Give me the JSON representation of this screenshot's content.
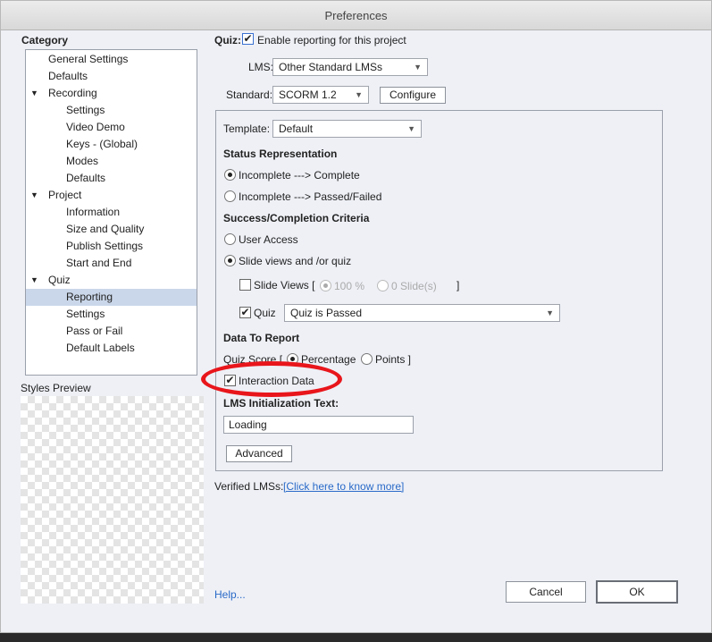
{
  "window": {
    "title": "Preferences"
  },
  "sidebar": {
    "heading": "Category",
    "items": [
      {
        "label": "General Settings",
        "level": 0
      },
      {
        "label": "Defaults",
        "level": 0
      },
      {
        "label": "Recording",
        "level": 0,
        "expanded": true
      },
      {
        "label": "Settings",
        "level": 1
      },
      {
        "label": "Video Demo",
        "level": 1
      },
      {
        "label": "Keys - (Global)",
        "level": 1
      },
      {
        "label": "Modes",
        "level": 1
      },
      {
        "label": "Defaults",
        "level": 1
      },
      {
        "label": "Project",
        "level": 0,
        "expanded": true
      },
      {
        "label": "Information",
        "level": 1
      },
      {
        "label": "Size and Quality",
        "level": 1
      },
      {
        "label": "Publish Settings",
        "level": 1
      },
      {
        "label": "Start and End",
        "level": 1
      },
      {
        "label": "Quiz",
        "level": 0,
        "expanded": true
      },
      {
        "label": "Reporting",
        "level": 1,
        "selected": true
      },
      {
        "label": "Settings",
        "level": 1
      },
      {
        "label": "Pass or Fail",
        "level": 1
      },
      {
        "label": "Default Labels",
        "level": 1
      }
    ]
  },
  "styles_preview": {
    "label": "Styles Preview"
  },
  "main": {
    "quiz_label": "Quiz:",
    "enable_label": "Enable reporting for this project",
    "enable_checked": true,
    "lms_label": "LMS:",
    "lms_value": "Other Standard LMSs",
    "standard_label": "Standard:",
    "standard_value": "SCORM 1.2",
    "configure_label": "Configure",
    "template_label": "Template:",
    "template_value": "Default",
    "status_heading": "Status Representation",
    "status_options": [
      {
        "label": "Incomplete ---> Complete",
        "selected": true
      },
      {
        "label": "Incomplete ---> Passed/Failed",
        "selected": false
      }
    ],
    "criteria_heading": "Success/Completion Criteria",
    "criteria_options": [
      {
        "label": "User Access",
        "selected": false
      },
      {
        "label": "Slide views and /or quiz",
        "selected": true
      }
    ],
    "slide_views_label": "Slide Views [",
    "slide_views_checked": false,
    "percent_value": "100 %",
    "slides_value": "0 Slide(s)",
    "bracket_close": "]",
    "quiz_cb_label": "Quiz",
    "quiz_cb_checked": true,
    "quiz_select_value": "Quiz is Passed",
    "data_heading": "Data To Report",
    "quiz_score_label": "Quiz Score  [",
    "percentage_label": "Percentage",
    "points_label": "Points ]",
    "score_selected": "Percentage",
    "interaction_label": "Interaction Data",
    "interaction_checked": true,
    "lms_init_heading": "LMS Initialization Text:",
    "lms_init_value": "Loading",
    "advanced_label": "Advanced",
    "verified_label": "Verified LMSs:",
    "verified_link": "[Click here to know more]"
  },
  "footer": {
    "help": "Help...",
    "cancel": "Cancel",
    "ok": "OK"
  },
  "colors": {
    "annotation": "#e8161b",
    "selection": "#cad7ea",
    "link": "#2a6ac8"
  }
}
